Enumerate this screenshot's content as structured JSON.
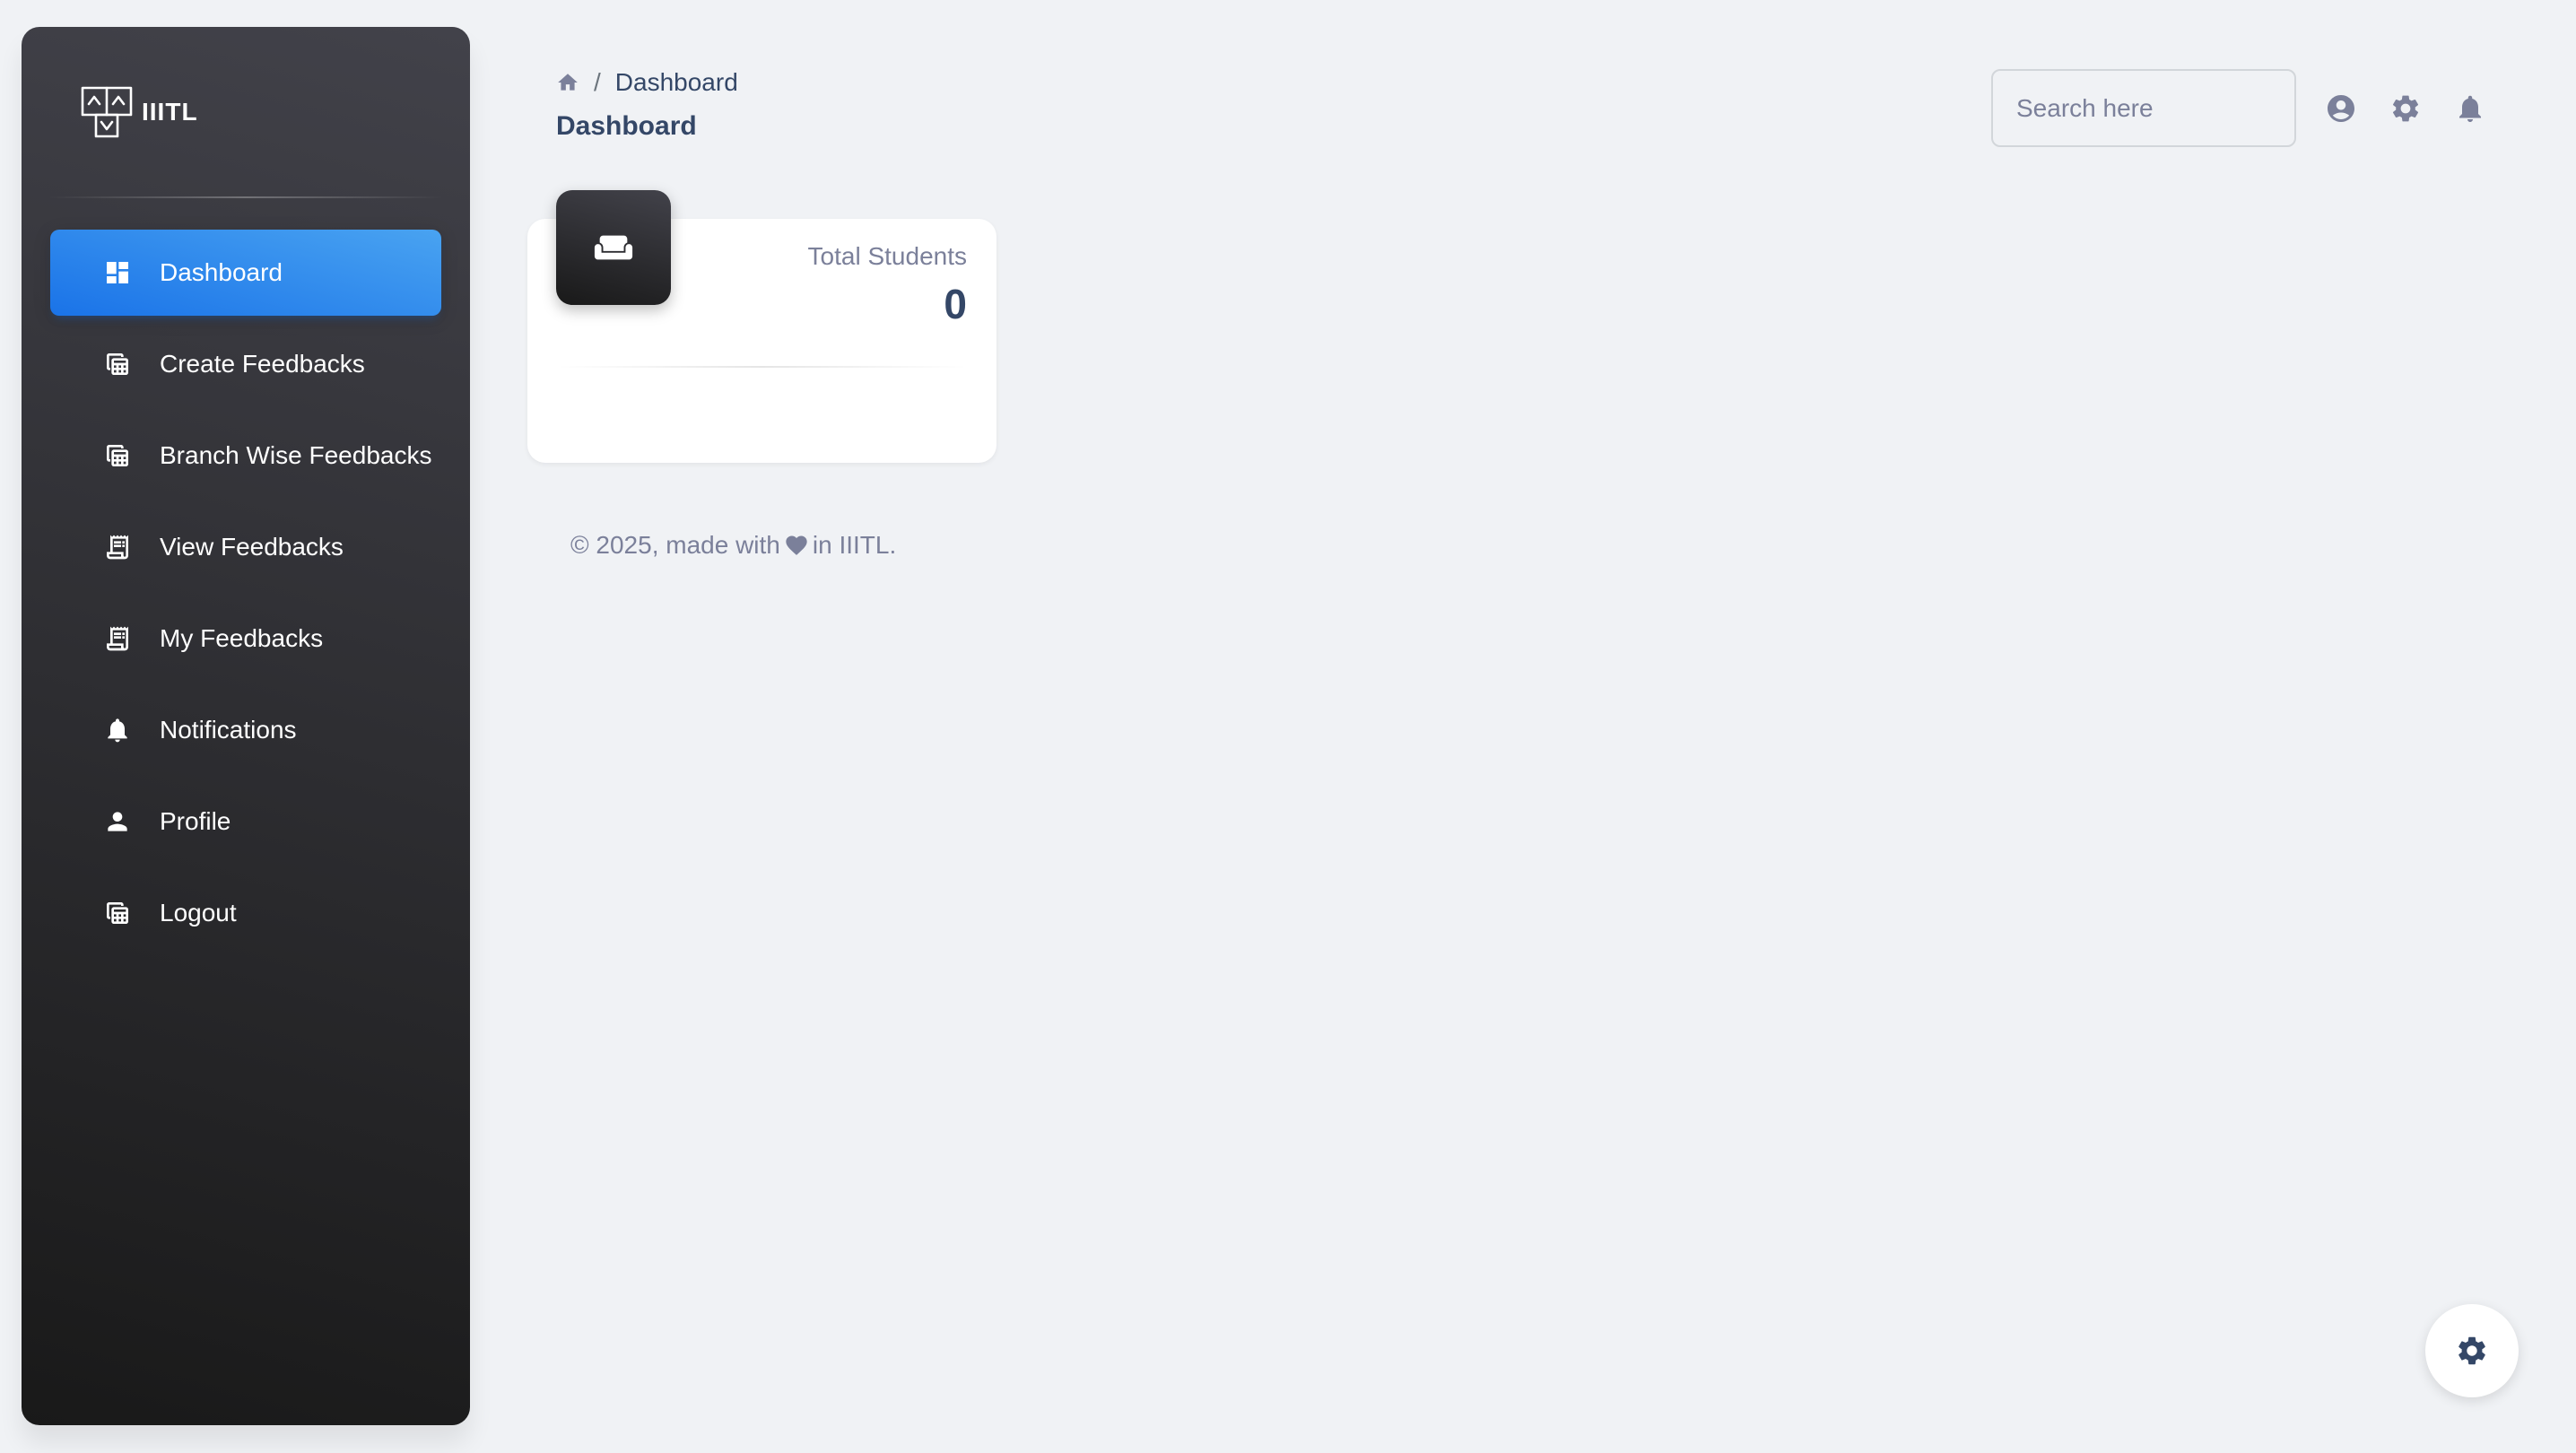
{
  "brand": {
    "name": "IIITL",
    "logo_icon": "iiitl-logo-icon"
  },
  "sidebar": {
    "items": [
      {
        "label": "Dashboard",
        "icon": "dashboard-icon",
        "active": true
      },
      {
        "label": "Create Feedbacks",
        "icon": "table-view-icon",
        "active": false
      },
      {
        "label": "Branch Wise Feedbacks",
        "icon": "table-view-icon",
        "active": false
      },
      {
        "label": "View Feedbacks",
        "icon": "receipt-long-icon",
        "active": false
      },
      {
        "label": "My Feedbacks",
        "icon": "receipt-long-icon",
        "active": false
      },
      {
        "label": "Notifications",
        "icon": "bell-icon",
        "active": false
      },
      {
        "label": "Profile",
        "icon": "person-icon",
        "active": false
      },
      {
        "label": "Logout",
        "icon": "table-view-icon",
        "active": false
      }
    ]
  },
  "header": {
    "breadcrumb_home_icon": "home-icon",
    "breadcrumb_separator": "/",
    "breadcrumb_current": "Dashboard",
    "title": "Dashboard",
    "search_placeholder": "Search here",
    "icons": [
      "account-circle-icon",
      "settings-icon",
      "notifications-icon"
    ]
  },
  "stats": {
    "card_icon": "weekend-icon",
    "label": "Total Students",
    "value": "0"
  },
  "footer": {
    "prefix": "© 2025, made with",
    "heart_icon": "heart-icon",
    "suffix": "in IIITL."
  },
  "config_button": {
    "icon": "settings-icon"
  },
  "colors": {
    "accent": "#1a73e8",
    "sidebar_dark": "#191919",
    "text_primary": "#344767",
    "text_secondary": "#7b809a",
    "background": "#f0f2f5"
  }
}
